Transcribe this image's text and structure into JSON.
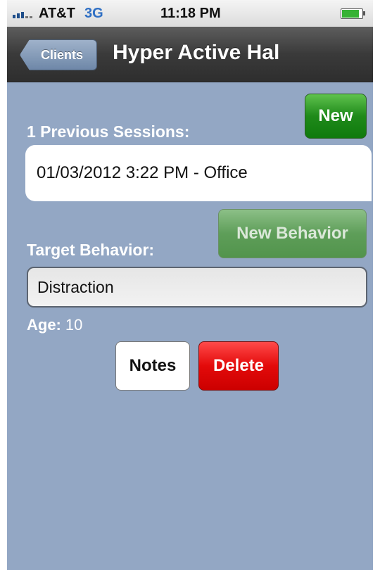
{
  "status_bar": {
    "carrier": "AT&T",
    "network": "3G",
    "time": "11:18 PM",
    "signal_icon": "signal-bars-icon",
    "battery_icon": "battery-icon",
    "battery_level": 0.85,
    "battery_color": "#37b234"
  },
  "nav": {
    "back_label": "Clients",
    "title": "Hyper Active Hal"
  },
  "sessions": {
    "label": "1 Previous Sessions:",
    "new_label": "New",
    "items": [
      {
        "text": "01/03/2012 3:22 PM - Office"
      }
    ]
  },
  "behavior": {
    "label": "Target Behavior:",
    "new_label": "New Behavior",
    "value": "Distraction"
  },
  "age": {
    "label": "Age:",
    "value": "10"
  },
  "actions": {
    "notes_label": "Notes",
    "delete_label": "Delete"
  },
  "colors": {
    "background": "#93a7c4",
    "new_button": "#1f8a1a",
    "delete_button": "#e30a0a",
    "nav_bar": "#3a3a3a"
  }
}
